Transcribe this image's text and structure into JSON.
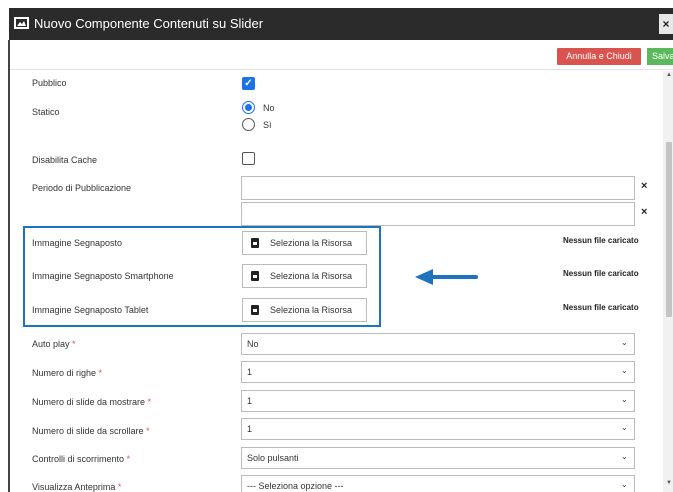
{
  "window": {
    "title": "Nuovo Componente Contenuti su Slider",
    "close_label": "×"
  },
  "toolbar": {
    "cancel_label": "Annulla e Chiudi",
    "save_label": "Salva"
  },
  "form": {
    "pubblico": {
      "label": "Pubblico",
      "checked": true
    },
    "statico": {
      "label": "Statico",
      "options": [
        "No",
        "Sì"
      ],
      "selected": "No"
    },
    "disabilita_cache": {
      "label": "Disabilita Cache",
      "checked": false
    },
    "periodo": {
      "label": "Periodo di Pubblicazione",
      "clear_label": "×"
    },
    "resources": [
      {
        "label": "Immagine Segnaposto",
        "button_label": "Seleziona la Risorsa",
        "status": "Nessun file caricato"
      },
      {
        "label": "Immagine Segnaposto Smartphone",
        "button_label": "Seleziona la Risorsa",
        "status": "Nessun file caricato"
      },
      {
        "label": "Immagine Segnaposto Tablet",
        "button_label": "Seleziona la Risorsa",
        "status": "Nessun file caricato"
      }
    ],
    "selects": [
      {
        "label": "Auto play",
        "required": "*",
        "value": "No"
      },
      {
        "label": "Numero di righe",
        "required": "*",
        "value": "1"
      },
      {
        "label": "Numero di slide da mostrare",
        "required": "*",
        "value": "1"
      },
      {
        "label": "Numero di slide da scrollare",
        "required": "*",
        "value": "1"
      },
      {
        "label": "Controlli di scorrimento",
        "required": "*",
        "value": "Solo pulsanti"
      },
      {
        "label": "Visualizza Anteprima",
        "required": "*",
        "value": "--- Seleziona opzione ---"
      }
    ]
  },
  "colors": {
    "titlebar": "#2b2b2b",
    "cancel": "#d9534f",
    "save": "#5cb85c",
    "accent": "#1a73e8",
    "highlight": "#1e73be"
  }
}
